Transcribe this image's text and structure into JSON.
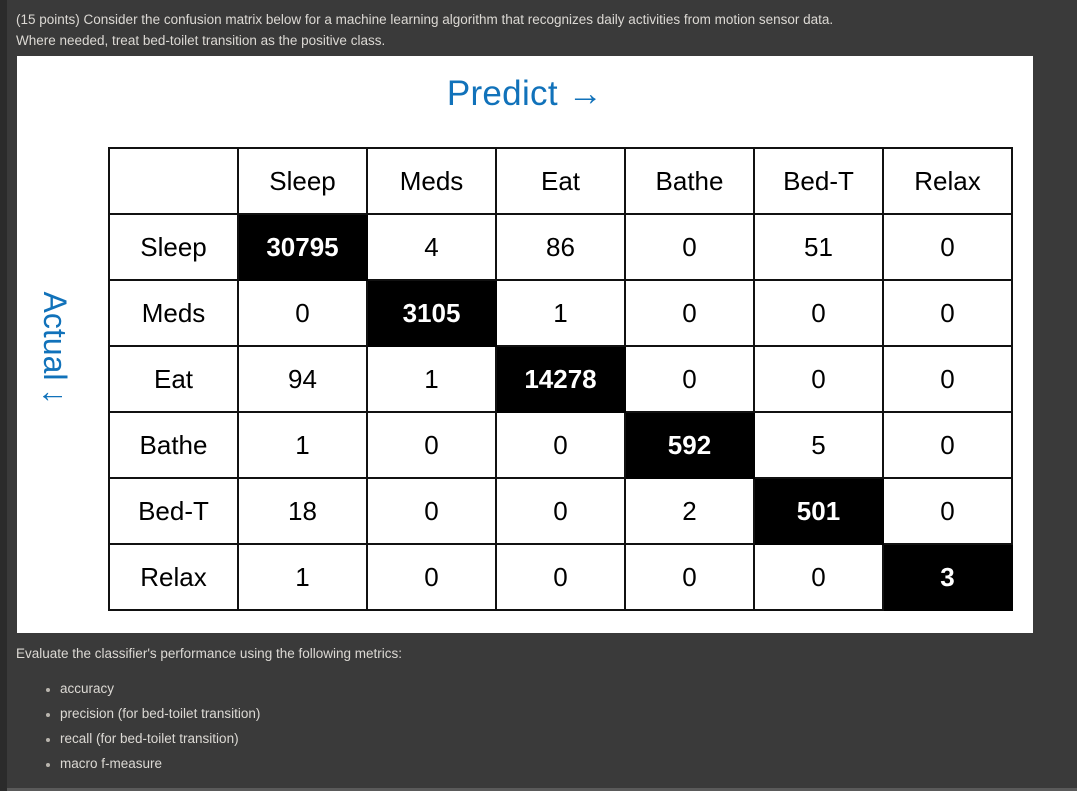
{
  "prompt": {
    "line1": "(15 points) Consider the confusion matrix below for a machine learning algorithm that recognizes daily activities from motion sensor data.",
    "line2": "Where needed, treat bed-toilet transition as the positive class."
  },
  "matrix_panel": {
    "predict_title": "Predict →",
    "actual_label": "Actual",
    "actual_arrow": "↓",
    "corner_label": ""
  },
  "metrics": {
    "lead": "Evaluate the classifier's performance using the following metrics:",
    "items": [
      "accuracy",
      "precision (for bed-toilet transition)",
      "recall (for bed-toilet transition)",
      "macro f-measure"
    ]
  },
  "colors": {
    "page_background": "#3a3a3a",
    "gutter": "#2b2b2b",
    "panel_background": "#ffffff",
    "accent_blue": "#1172ba",
    "body_text": "#dcd9d4",
    "grid_line": "#111111",
    "diagonal_fill": "#000000",
    "diagonal_text": "#ffffff"
  },
  "chart_data": {
    "type": "table",
    "title": "Confusion matrix: daily activity recognition from motion sensor data",
    "xlabel": "Predict →",
    "ylabel": "Actual ↓",
    "categories": [
      "Sleep",
      "Meds",
      "Eat",
      "Bathe",
      "Bed-T",
      "Relax"
    ],
    "column_headers": [
      "",
      "Sleep",
      "Meds",
      "Eat",
      "Bathe",
      "Bed-T",
      "Relax"
    ],
    "row_headers": [
      "Sleep",
      "Meds",
      "Eat",
      "Bathe",
      "Bed-T",
      "Relax"
    ],
    "matrix": [
      [
        30795,
        4,
        86,
        0,
        51,
        0
      ],
      [
        0,
        3105,
        1,
        0,
        0,
        0
      ],
      [
        94,
        1,
        14278,
        0,
        0,
        0
      ],
      [
        1,
        0,
        0,
        592,
        5,
        0
      ],
      [
        18,
        0,
        0,
        2,
        501,
        0
      ],
      [
        1,
        0,
        0,
        0,
        0,
        3
      ]
    ],
    "highlight": "diagonal",
    "positive_class": "Bed-T"
  }
}
